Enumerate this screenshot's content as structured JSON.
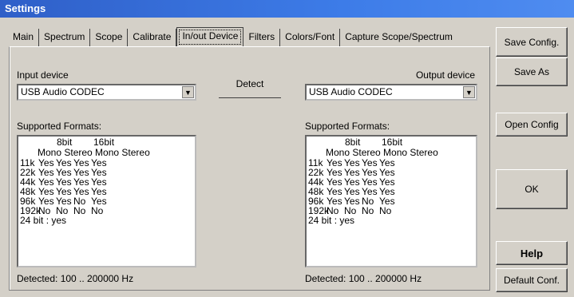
{
  "window": {
    "title": "Settings"
  },
  "tabs": [
    {
      "label": "Main",
      "active": false
    },
    {
      "label": "Spectrum",
      "active": false
    },
    {
      "label": "Scope",
      "active": false
    },
    {
      "label": "Calibrate",
      "active": false
    },
    {
      "label": "In/out Device",
      "active": true
    },
    {
      "label": "Filters",
      "active": false
    },
    {
      "label": "Colors/Font",
      "active": false
    },
    {
      "label": "Capture Scope/Spectrum",
      "active": false
    }
  ],
  "input": {
    "label": "Input device",
    "device": "USB Audio CODEC",
    "formats_label": "Supported Formats:",
    "detected": "Detected: 100 .. 200000 Hz"
  },
  "output": {
    "label": "Output device",
    "device": "USB Audio CODEC",
    "formats_label": "Supported Formats:",
    "detected": "Detected: 100 .. 200000 Hz"
  },
  "detect_button": "Detect",
  "formats": {
    "bits_header": [
      "8bit",
      "16bit"
    ],
    "channels_header": "Mono Stereo Mono Stereo",
    "rows": [
      {
        "rate": "11k",
        "values": [
          "Yes",
          "Yes",
          "Yes",
          "Yes"
        ]
      },
      {
        "rate": "22k",
        "values": [
          "Yes",
          "Yes",
          "Yes",
          "Yes"
        ]
      },
      {
        "rate": "44k",
        "values": [
          "Yes",
          "Yes",
          "Yes",
          "Yes"
        ]
      },
      {
        "rate": "48k",
        "values": [
          "Yes",
          "Yes",
          "Yes",
          "Yes"
        ]
      },
      {
        "rate": "96k",
        "values": [
          "Yes",
          "Yes",
          "No",
          "Yes"
        ]
      },
      {
        "rate": "192k",
        "values": [
          "No",
          "No",
          "No",
          "No"
        ]
      }
    ],
    "footer": "24 bit : yes"
  },
  "sidebar": {
    "save_config": "Save Config.",
    "save_as": "Save As",
    "open_config": "Open Config",
    "ok": "OK",
    "help": "Help",
    "default_conf": "Default Conf."
  }
}
